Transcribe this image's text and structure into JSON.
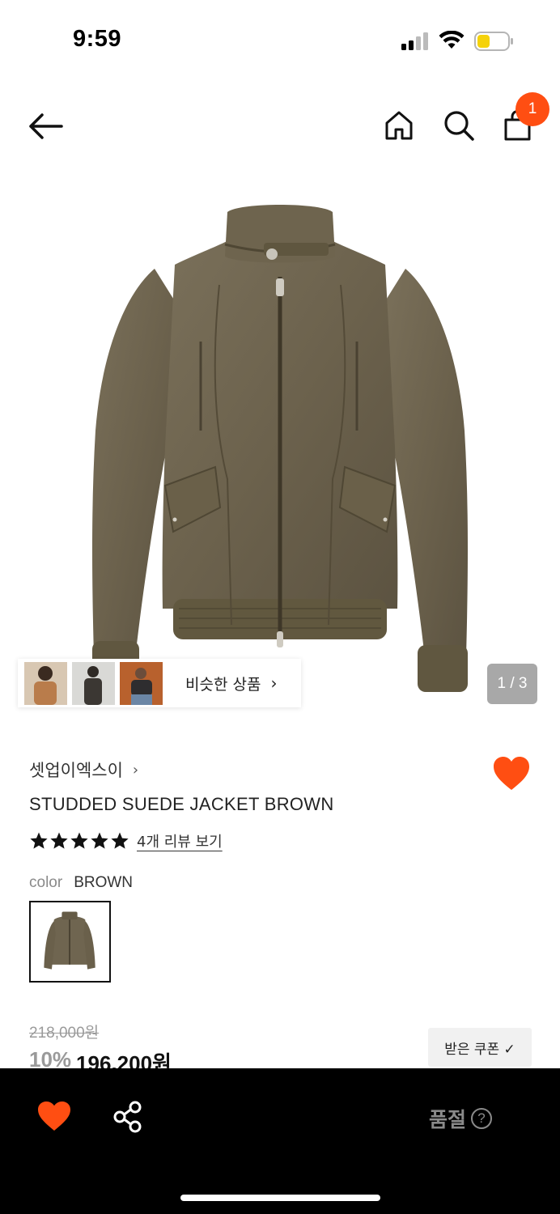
{
  "status_bar": {
    "time": "9:59"
  },
  "nav": {
    "icons": [
      "back-arrow-icon",
      "home-icon",
      "search-icon",
      "shopping-bag-icon"
    ],
    "cart_count": "1"
  },
  "gallery": {
    "similar_label": "비슷한 상품",
    "similar_chevron": "›",
    "page_indicator": "1 / 3"
  },
  "product": {
    "brand": "셋업이엑스이",
    "brand_chevron": "›",
    "name": "STUDDED SUEDE JACKET BROWN",
    "rating_stars": 5,
    "review_link": "4개 리뷰 보기",
    "option_label": "color",
    "option_value": "BROWN",
    "original_price": "218,000원",
    "discount": "10%",
    "sale_price": "196,200원",
    "coupon_label": "받은 쿠폰 ✓"
  },
  "bottom_bar": {
    "soldout_label": "품절",
    "help_glyph": "?"
  },
  "colors": {
    "accent": "#ff4e12",
    "jacket": "#6f6550",
    "bottom_bar": "#000000"
  }
}
